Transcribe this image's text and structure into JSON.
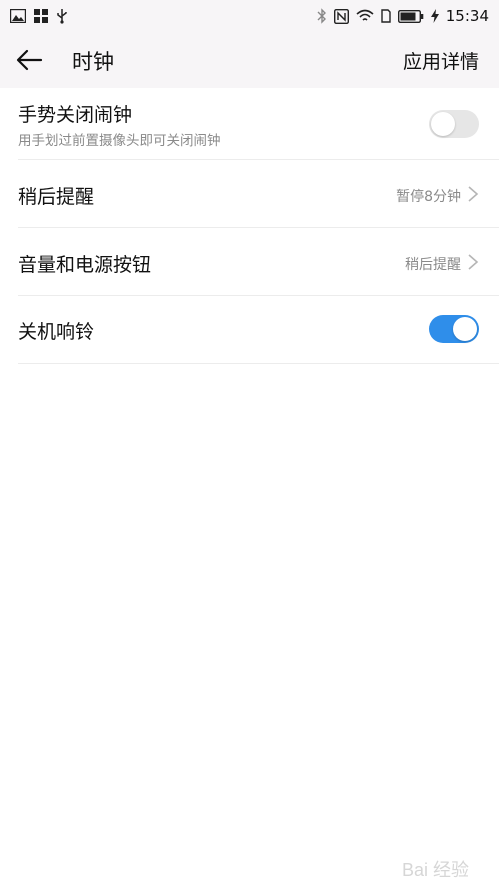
{
  "status_bar": {
    "time": "15:34",
    "left_icons": [
      "image-icon",
      "grid-icon",
      "usb-icon"
    ],
    "right_icons": [
      "bluetooth-icon",
      "nfc-icon",
      "wifi-icon",
      "sim-icon",
      "battery-icon",
      "charging-icon"
    ]
  },
  "header": {
    "title": "时钟",
    "app_details_label": "应用详情"
  },
  "settings": {
    "gesture_close": {
      "title": "手势关闭闹钟",
      "subtitle": "用手划过前置摄像头即可关闭闹钟",
      "enabled": false
    },
    "snooze": {
      "title": "稍后提醒",
      "value": "暂停8分钟"
    },
    "volume_power": {
      "title": "音量和电源按钮",
      "value": "稍后提醒"
    },
    "ring_when_off": {
      "title": "关机响铃",
      "enabled": true
    }
  },
  "watermark": "Bai 经验",
  "colors": {
    "accent": "#2f8eea",
    "bar_bg": "#f7f5f7",
    "toggle_off": "#e6e6e6",
    "secondary_text": "#8a8a8a"
  }
}
